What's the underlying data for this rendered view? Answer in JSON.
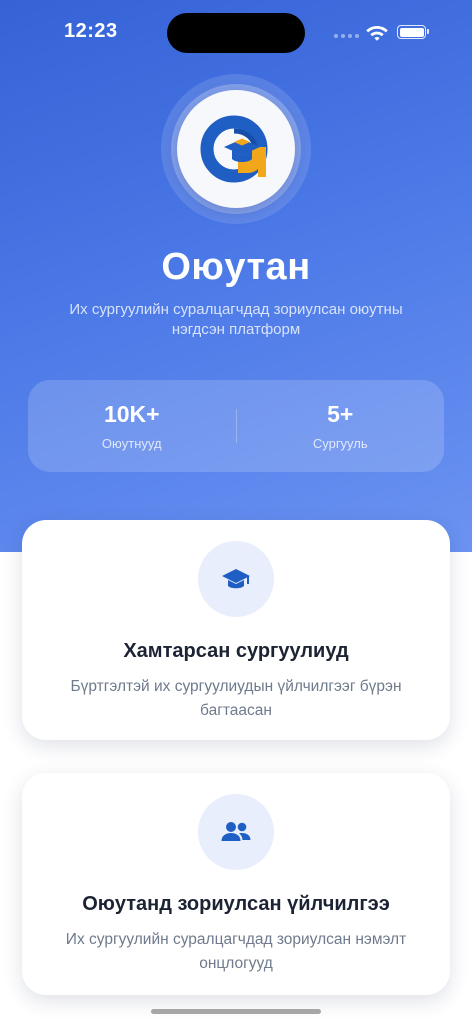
{
  "status_bar": {
    "time": "12:23",
    "wifi_icon": "wifi-icon",
    "battery_icon": "battery-icon"
  },
  "hero": {
    "logo_icon": "app-logo-icon",
    "title": "Оюутан",
    "subtitle": "Их сургуулийн суралцагчдад зориулсан оюутны нэгдсэн платформ"
  },
  "stats": [
    {
      "value": "10K+",
      "label": "Оюутнууд"
    },
    {
      "value": "5+",
      "label": "Сургууль"
    }
  ],
  "cards": [
    {
      "icon": "graduation-cap-icon",
      "title": "Хамтарсан сургуулиуд",
      "description": "Бүртгэлтэй их сургуулиудын үйлчилгээг бүрэн багтаасан"
    },
    {
      "icon": "users-icon",
      "title": "Оюутанд зориулсан үйлчилгээ",
      "description": "Их сургуулийн суралцагчдад зориулсан нэмэлт онцлогууд"
    }
  ],
  "colors": {
    "primary": "#3562d6",
    "primary_light": "#6b93f2",
    "logo_blue": "#1f5fc4",
    "logo_orange": "#f2a71b",
    "card_icon_bg": "#e8eefb",
    "text_dark": "#1c2333",
    "text_muted": "#6f7a8c"
  }
}
